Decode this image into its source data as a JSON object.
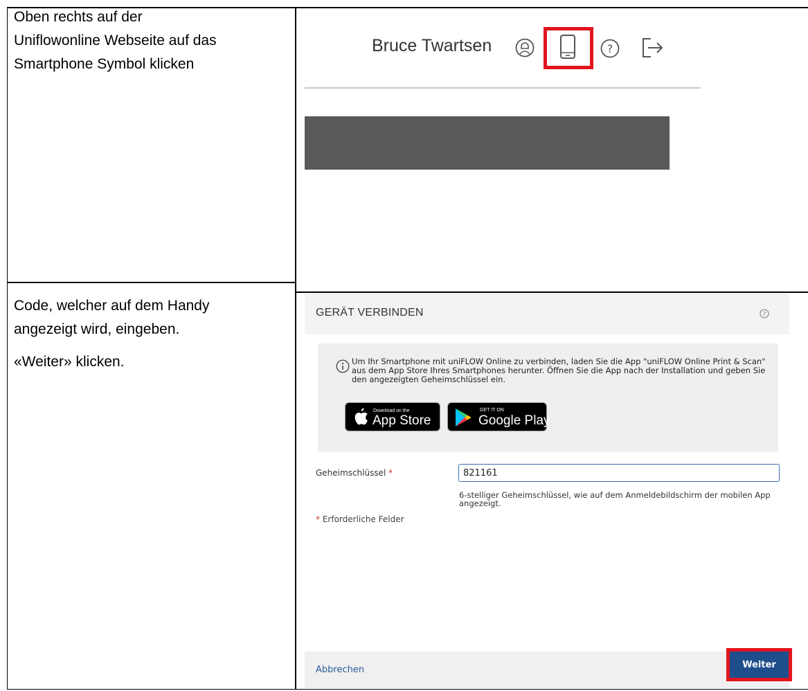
{
  "steps": [
    {
      "instruction": [
        "Oben rechts auf der",
        "Uniflowonline Webseite auf das",
        "Smartphone Symbol klicken"
      ],
      "screen": {
        "user_name": "Bruce Twartsen",
        "icons": [
          "user-profile-icon",
          "smartphone-icon",
          "help-icon",
          "logout-icon"
        ],
        "highlighted_icon": "smartphone-icon"
      }
    },
    {
      "instruction": [
        "Code, welcher auf dem Handy",
        "angezeigt wird, eingeben.",
        "«Weiter» klicken."
      ],
      "screen": {
        "title": "GERÄT VERBINDEN",
        "info_text": "Um Ihr Smartphone mit uniFLOW Online zu verbinden, laden Sie die App \"uniFLOW Online Print & Scan\" aus dem App Store Ihres Smartphones herunter. Öffnen Sie die App nach der Installation und geben Sie den angezeigten Geheimschlüssel ein.",
        "app_store": {
          "small": "Download on the",
          "big": "App Store"
        },
        "google_play": {
          "small": "GET IT ON",
          "big": "Google Play"
        },
        "field_label": "Geheimschlüssel",
        "required_mark": "*",
        "field_value": "821161",
        "field_hint": "6-stelliger Geheimschlüssel, wie auf dem Anmeldebildschirm der mobilen App angezeigt.",
        "required_note": "Erforderliche Felder",
        "cancel_label": "Abbrechen",
        "next_label": "Weiter"
      }
    }
  ],
  "colors": {
    "highlight": "#e3141e",
    "primary_button": "#1f4e8c",
    "redacted_block": "#595959"
  }
}
